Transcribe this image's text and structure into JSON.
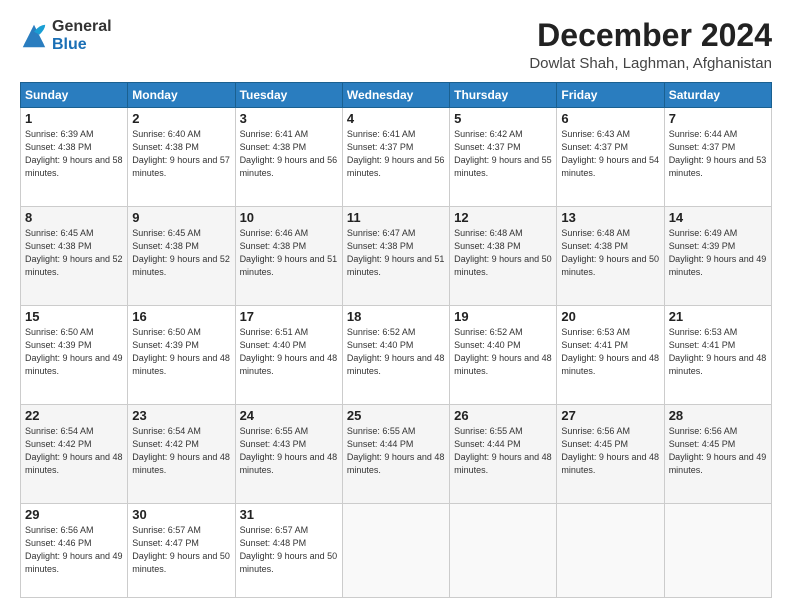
{
  "logo": {
    "general": "General",
    "blue": "Blue"
  },
  "title": "December 2024",
  "location": "Dowlat Shah, Laghman, Afghanistan",
  "days_of_week": [
    "Sunday",
    "Monday",
    "Tuesday",
    "Wednesday",
    "Thursday",
    "Friday",
    "Saturday"
  ],
  "weeks": [
    [
      {
        "day": "1",
        "sunrise": "6:39 AM",
        "sunset": "4:38 PM",
        "daylight": "9 hours and 58 minutes."
      },
      {
        "day": "2",
        "sunrise": "6:40 AM",
        "sunset": "4:38 PM",
        "daylight": "9 hours and 57 minutes."
      },
      {
        "day": "3",
        "sunrise": "6:41 AM",
        "sunset": "4:38 PM",
        "daylight": "9 hours and 56 minutes."
      },
      {
        "day": "4",
        "sunrise": "6:41 AM",
        "sunset": "4:37 PM",
        "daylight": "9 hours and 56 minutes."
      },
      {
        "day": "5",
        "sunrise": "6:42 AM",
        "sunset": "4:37 PM",
        "daylight": "9 hours and 55 minutes."
      },
      {
        "day": "6",
        "sunrise": "6:43 AM",
        "sunset": "4:37 PM",
        "daylight": "9 hours and 54 minutes."
      },
      {
        "day": "7",
        "sunrise": "6:44 AM",
        "sunset": "4:37 PM",
        "daylight": "9 hours and 53 minutes."
      }
    ],
    [
      {
        "day": "8",
        "sunrise": "6:45 AM",
        "sunset": "4:38 PM",
        "daylight": "9 hours and 52 minutes."
      },
      {
        "day": "9",
        "sunrise": "6:45 AM",
        "sunset": "4:38 PM",
        "daylight": "9 hours and 52 minutes."
      },
      {
        "day": "10",
        "sunrise": "6:46 AM",
        "sunset": "4:38 PM",
        "daylight": "9 hours and 51 minutes."
      },
      {
        "day": "11",
        "sunrise": "6:47 AM",
        "sunset": "4:38 PM",
        "daylight": "9 hours and 51 minutes."
      },
      {
        "day": "12",
        "sunrise": "6:48 AM",
        "sunset": "4:38 PM",
        "daylight": "9 hours and 50 minutes."
      },
      {
        "day": "13",
        "sunrise": "6:48 AM",
        "sunset": "4:38 PM",
        "daylight": "9 hours and 50 minutes."
      },
      {
        "day": "14",
        "sunrise": "6:49 AM",
        "sunset": "4:39 PM",
        "daylight": "9 hours and 49 minutes."
      }
    ],
    [
      {
        "day": "15",
        "sunrise": "6:50 AM",
        "sunset": "4:39 PM",
        "daylight": "9 hours and 49 minutes."
      },
      {
        "day": "16",
        "sunrise": "6:50 AM",
        "sunset": "4:39 PM",
        "daylight": "9 hours and 48 minutes."
      },
      {
        "day": "17",
        "sunrise": "6:51 AM",
        "sunset": "4:40 PM",
        "daylight": "9 hours and 48 minutes."
      },
      {
        "day": "18",
        "sunrise": "6:52 AM",
        "sunset": "4:40 PM",
        "daylight": "9 hours and 48 minutes."
      },
      {
        "day": "19",
        "sunrise": "6:52 AM",
        "sunset": "4:40 PM",
        "daylight": "9 hours and 48 minutes."
      },
      {
        "day": "20",
        "sunrise": "6:53 AM",
        "sunset": "4:41 PM",
        "daylight": "9 hours and 48 minutes."
      },
      {
        "day": "21",
        "sunrise": "6:53 AM",
        "sunset": "4:41 PM",
        "daylight": "9 hours and 48 minutes."
      }
    ],
    [
      {
        "day": "22",
        "sunrise": "6:54 AM",
        "sunset": "4:42 PM",
        "daylight": "9 hours and 48 minutes."
      },
      {
        "day": "23",
        "sunrise": "6:54 AM",
        "sunset": "4:42 PM",
        "daylight": "9 hours and 48 minutes."
      },
      {
        "day": "24",
        "sunrise": "6:55 AM",
        "sunset": "4:43 PM",
        "daylight": "9 hours and 48 minutes."
      },
      {
        "day": "25",
        "sunrise": "6:55 AM",
        "sunset": "4:44 PM",
        "daylight": "9 hours and 48 minutes."
      },
      {
        "day": "26",
        "sunrise": "6:55 AM",
        "sunset": "4:44 PM",
        "daylight": "9 hours and 48 minutes."
      },
      {
        "day": "27",
        "sunrise": "6:56 AM",
        "sunset": "4:45 PM",
        "daylight": "9 hours and 48 minutes."
      },
      {
        "day": "28",
        "sunrise": "6:56 AM",
        "sunset": "4:45 PM",
        "daylight": "9 hours and 49 minutes."
      }
    ],
    [
      {
        "day": "29",
        "sunrise": "6:56 AM",
        "sunset": "4:46 PM",
        "daylight": "9 hours and 49 minutes."
      },
      {
        "day": "30",
        "sunrise": "6:57 AM",
        "sunset": "4:47 PM",
        "daylight": "9 hours and 50 minutes."
      },
      {
        "day": "31",
        "sunrise": "6:57 AM",
        "sunset": "4:48 PM",
        "daylight": "9 hours and 50 minutes."
      },
      null,
      null,
      null,
      null
    ]
  ],
  "labels": {
    "sunrise": "Sunrise:",
    "sunset": "Sunset:",
    "daylight": "Daylight:"
  }
}
